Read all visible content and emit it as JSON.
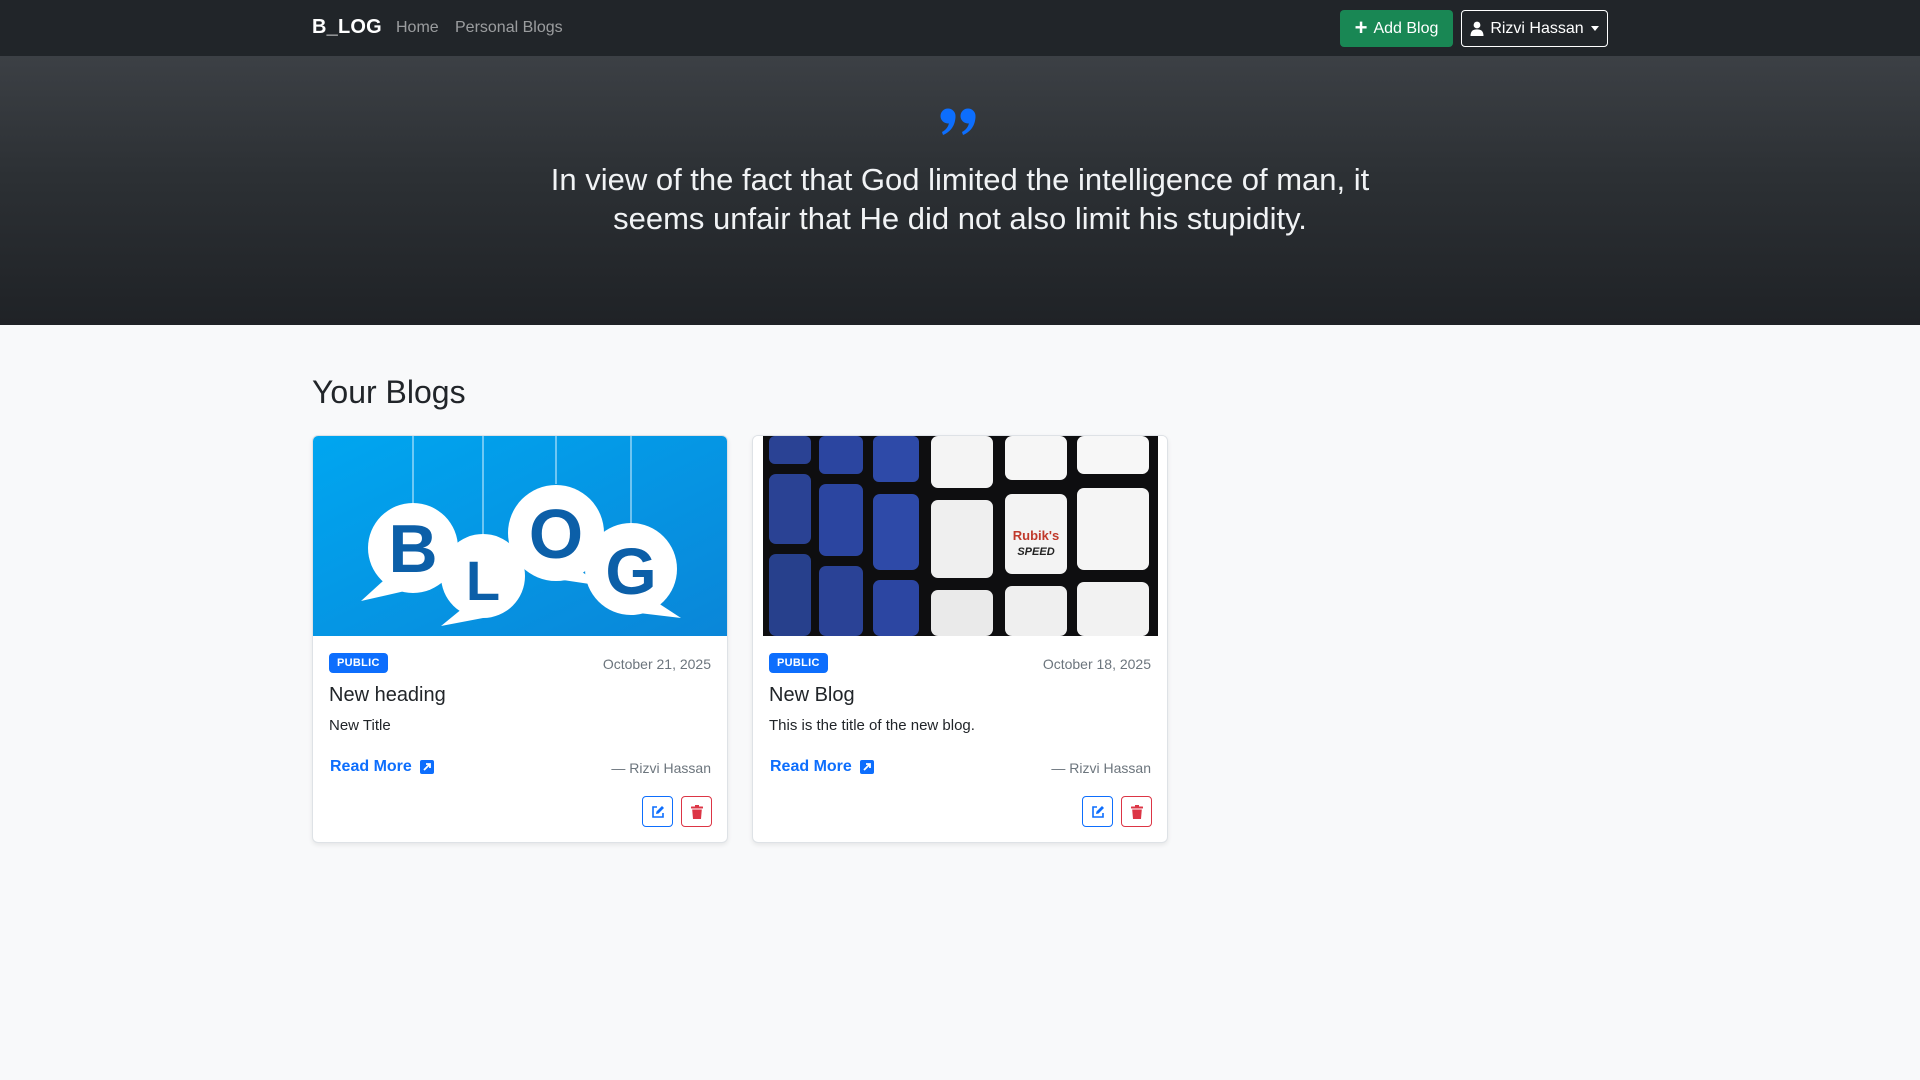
{
  "navbar": {
    "brand": "B_LOG",
    "links": [
      "Home",
      "Personal Blogs"
    ],
    "add_blog_label": "Add Blog",
    "user_name": "Rizvi Hassan"
  },
  "hero": {
    "quote": "In view of the fact that God limited the intelligence of man, it seems unfair that He did not also limit his stupidity."
  },
  "main": {
    "section_title": "Your Blogs",
    "cards": [
      {
        "badge": "PUBLIC",
        "date": "October 21, 2025",
        "title": "New heading",
        "text": "New Title",
        "read_more": "Read More",
        "author": "— Rizvi Hassan",
        "image_word": "BLOG"
      },
      {
        "badge": "PUBLIC",
        "date": "October 18, 2025",
        "title": "New Blog",
        "text": "This is the title of the new blog.",
        "read_more": "Read More",
        "author": "— Rizvi Hassan",
        "image_logo": "Rubik's SPEED"
      }
    ]
  },
  "colors": {
    "navbar_bg": "#212529",
    "primary": "#0d6efd",
    "success": "#198754",
    "danger": "#dc3545"
  }
}
